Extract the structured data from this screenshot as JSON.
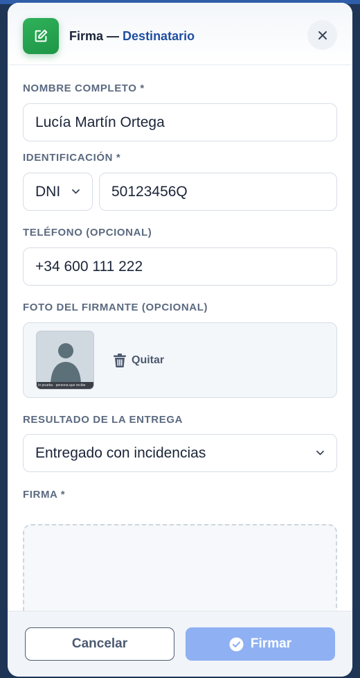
{
  "header": {
    "title_prefix": "Firma",
    "title_sep": " — ",
    "title_accent": "Destinatario",
    "icon": "edit-square-icon",
    "close_icon": "close-icon"
  },
  "form": {
    "full_name": {
      "label": "NOMBRE COMPLETO *",
      "value": "Lucía Martín Ortega"
    },
    "identification": {
      "label": "IDENTIFICACIÓN *",
      "type": "DNI",
      "number": "50123456Q"
    },
    "phone": {
      "label": "TELÉFONO (OPCIONAL)",
      "value": "+34 600 111 222"
    },
    "photo": {
      "label": "FOTO DEL FIRMANTE (OPCIONAL)",
      "caption": "In prueba · persona que recibe",
      "remove_label": "Quitar"
    },
    "result": {
      "label": "RESULTADO DE LA ENTREGA",
      "value": "Entregado con incidencias"
    },
    "signature": {
      "label": "FIRMA *"
    }
  },
  "footer": {
    "cancel_label": "Cancelar",
    "sign_label": "Firmar"
  },
  "colors": {
    "accent": "#1f4fa0",
    "success": "#2fb15a",
    "primary_disabled": "#8fb1f3",
    "label": "#5b6a80"
  }
}
